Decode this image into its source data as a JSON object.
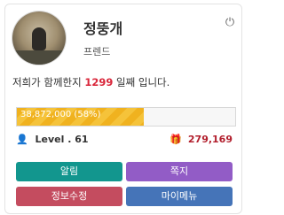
{
  "profile": {
    "name": "정뚱개",
    "level_label": "프렌드",
    "days_prefix": "저희가 함께한지",
    "days_count": "1299",
    "days_suffix": "일째 입니다."
  },
  "experience": {
    "text": "38,872,000 (58%)",
    "percent": 58
  },
  "level": {
    "text": "Level . 61",
    "icon": "user-icon"
  },
  "points": {
    "value": "279,169",
    "icon": "gift-icon"
  },
  "buttons": {
    "alarm": "알림",
    "note": "쪽지",
    "edit_info": "정보수정",
    "my_menu": "마이메뉴"
  },
  "colors": {
    "alarm": "#12968e",
    "note": "#925cc6",
    "edit_info": "#c44c5f",
    "my_menu": "#4574b8",
    "accent_red": "#d9263a",
    "progress": "#f0b21f"
  }
}
